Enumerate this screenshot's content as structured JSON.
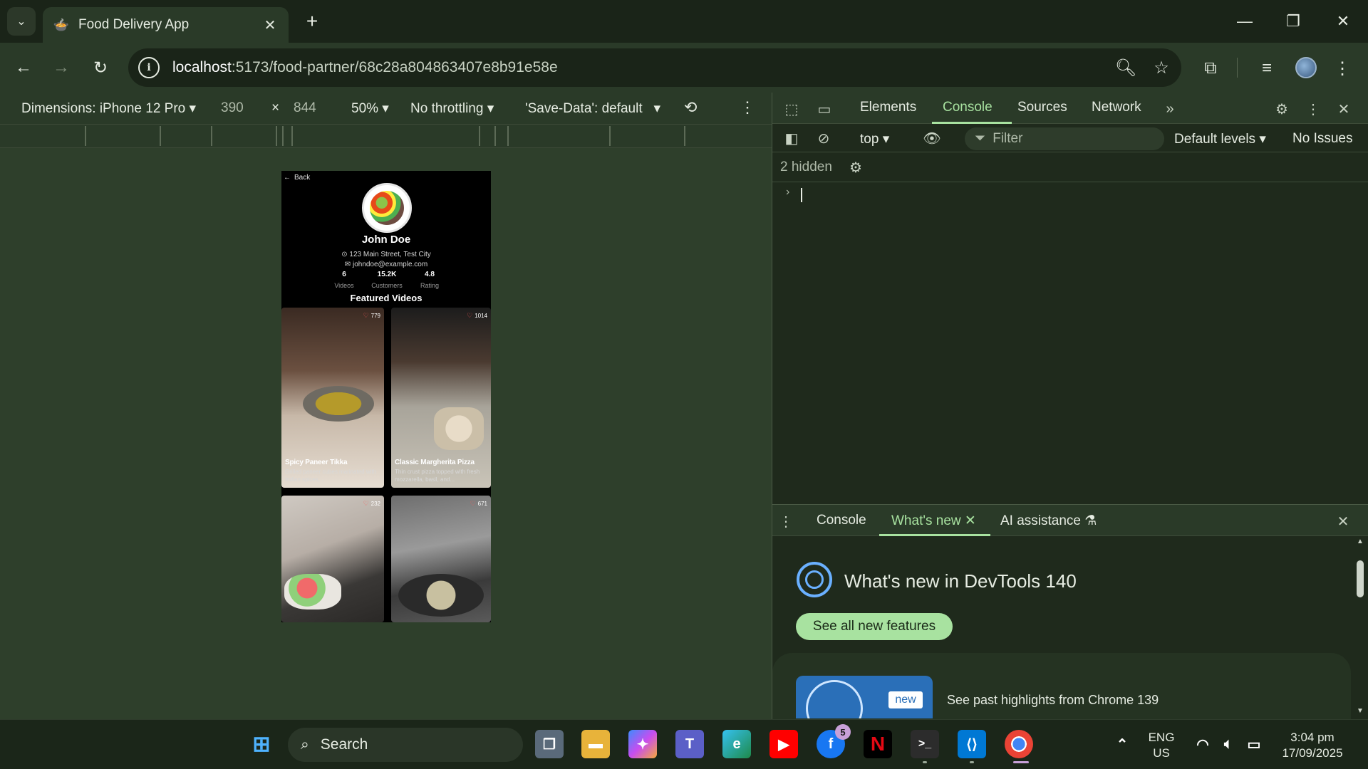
{
  "browser": {
    "tab_title": "Food Delivery App",
    "url_host": "localhost",
    "url_path": ":5173/food-partner/68c28a804863407e8b91e58e"
  },
  "device_toolbar": {
    "dimensions_label": "Dimensions: iPhone 12 Pro",
    "width": "390",
    "times": "×",
    "height": "844",
    "zoom": "50%",
    "throttling": "No throttling",
    "save_data": "'Save-Data': default"
  },
  "app": {
    "back_label": "Back",
    "name": "John Doe",
    "address": "123 Main Street, Test City",
    "email": "johndoe@example.com",
    "stats": [
      {
        "value": "6",
        "label": "Videos"
      },
      {
        "value": "15.2K",
        "label": "Customers"
      },
      {
        "value": "4.8",
        "label": "Rating"
      }
    ],
    "featured_heading": "Featured Videos",
    "videos": [
      {
        "likes": "779",
        "title": "Spicy Paneer Tikka",
        "desc": "Grilled paneer cubes marinated with Indian spices,..."
      },
      {
        "likes": "1014",
        "title": "Classic Margherita Pizza",
        "desc": "Thin crust pizza topped with fresh mozzarella, basil, and..."
      },
      {
        "likes": "232",
        "title": "",
        "desc": ""
      },
      {
        "likes": "671",
        "title": "",
        "desc": ""
      }
    ]
  },
  "devtools": {
    "tabs": [
      "Elements",
      "Console",
      "Sources",
      "Network"
    ],
    "active_tab": "Console",
    "context": "top",
    "filter_placeholder": "Filter",
    "levels": "Default levels",
    "issues": "No Issues",
    "hidden_count": "2 hidden",
    "drawer_tabs": {
      "console": "Console",
      "whats_new": "What's new",
      "ai": "AI assistance"
    },
    "whats_new_title": "What's new in DevTools 140",
    "see_all": "See all new features",
    "new_badge": "new",
    "past_highlights": "See past highlights from Chrome 139"
  },
  "taskbar": {
    "search_label": "Search",
    "facebook_badge": "5",
    "lang_top": "ENG",
    "lang_bottom": "US",
    "time": "3:04 pm",
    "date": "17/09/2025"
  },
  "colors": {
    "accent": "#a8e2a0",
    "chrome_bg": "#1a2418",
    "toolbar_bg": "#2a3a28",
    "like_heart": "#ff5a5a"
  }
}
